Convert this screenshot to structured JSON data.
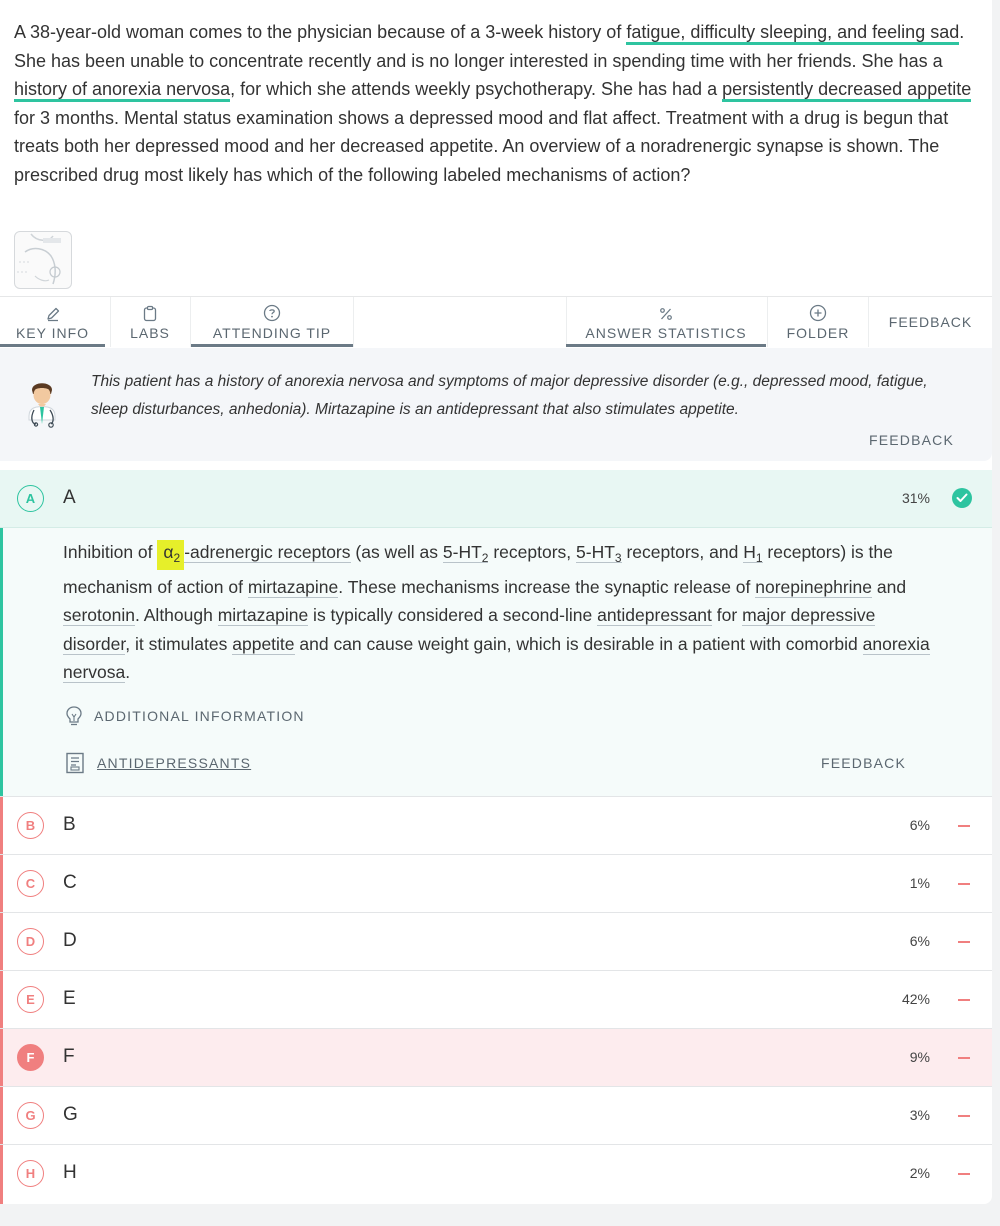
{
  "question": {
    "p1": "A 38-year-old woman comes to the physician because of a 3-week history of ",
    "h1": "fatigue, difficulty sleeping, and feeling sad",
    "p2": ". She has been unable to concentrate recently and is no longer interested in spending time with her friends. She has a ",
    "h2": "history of anorexia nervosa",
    "p3": ", for which she attends weekly psychotherapy. She has had a ",
    "h3": "persistently decreased appetite",
    "p4": " for 3 months. Mental status examination shows a depressed mood and flat affect. Treatment with a drug is begun that treats both her depressed mood and her decreased appetite. An overview of a noradrenergic synapse is shown. The prescribed drug most likely has which of the following labeled mechanisms of action?"
  },
  "toolbar": {
    "key_info": "KEY INFO",
    "labs": "LABS",
    "attending_tip": "ATTENDING TIP",
    "answer_statistics": "ANSWER STATISTICS",
    "folder": "FOLDER",
    "feedback": "FEEDBACK"
  },
  "tip": {
    "text": "This patient has a history of anorexia nervosa and symptoms of major depressive disorder (e.g., depressed mood, fatigue, sleep disturbances, anhedonia). Mirtazapine is an antidepressant that also stimulates appetite.",
    "feedback": "FEEDBACK"
  },
  "answer_a": {
    "badge": "A",
    "letter": "A",
    "pct": "31%",
    "e1": "Inhibition of ",
    "alpha": "α",
    "alpha_sub": "2",
    "e2": "-adrenergic receptors",
    "e3": " (as well as ",
    "e4": "5-HT",
    "e4_sub": "2",
    "e5": " receptors, ",
    "e6": "5-HT",
    "e6_sub": "3",
    "e7": " receptors, and ",
    "e8": "H",
    "e8_sub": "1",
    "e9": " receptors) is the mechanism of action of ",
    "e10": "mirtazapine",
    "e11": ". These mechanisms increase the synaptic release of ",
    "e12": "norepinephrine",
    "e13": " and ",
    "e14": "serotonin",
    "e15": ". Although ",
    "e16": "mirtazapine",
    "e17": " is typically considered a second-line ",
    "e18": "antidepressant",
    "e19": " for ",
    "e20": "major depressive disorder",
    "e21": ", it stimulates ",
    "e22": "appetite",
    "e23": " and can cause weight gain, which is desirable in a patient with comorbid ",
    "e24": "anorexia nervosa",
    "e25": ".",
    "additional": "ADDITIONAL INFORMATION",
    "article": "ANTIDEPRESSANTS",
    "feedback": "FEEDBACK"
  },
  "answers": [
    {
      "badge": "B",
      "letter": "B",
      "pct": "6%"
    },
    {
      "badge": "C",
      "letter": "C",
      "pct": "1%"
    },
    {
      "badge": "D",
      "letter": "D",
      "pct": "6%"
    },
    {
      "badge": "E",
      "letter": "E",
      "pct": "42%"
    },
    {
      "badge": "F",
      "letter": "F",
      "pct": "9%"
    },
    {
      "badge": "G",
      "letter": "G",
      "pct": "3%"
    },
    {
      "badge": "H",
      "letter": "H",
      "pct": "2%"
    }
  ],
  "colors": {
    "correct": "#2ec4a0",
    "incorrect": "#f07f7f",
    "selected_bg": "#fdecee",
    "highlight": "#e6ef2a"
  }
}
